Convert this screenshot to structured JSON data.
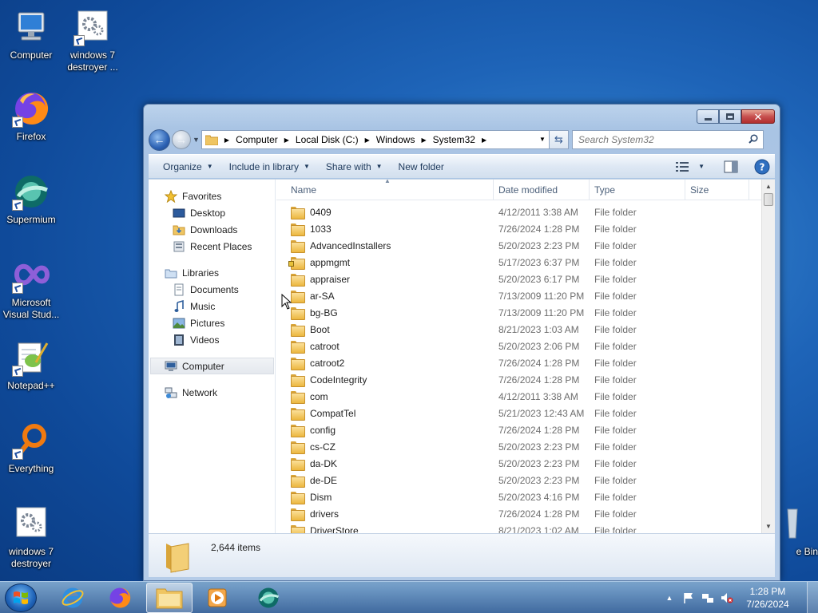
{
  "desktop": {
    "icons": [
      {
        "label": "Computer"
      },
      {
        "label": "windows 7 destroyer ..."
      },
      {
        "label": "Firefox"
      },
      {
        "label": "Supermium"
      },
      {
        "label": "Microsoft Visual Stud..."
      },
      {
        "label": "Notepad++"
      },
      {
        "label": "Everything"
      },
      {
        "label": "windows 7 destroyer"
      },
      {
        "label": "e Bin"
      }
    ]
  },
  "explorer": {
    "address": {
      "crumbs": [
        "Computer",
        "Local Disk (C:)",
        "Windows",
        "System32"
      ]
    },
    "search": {
      "placeholder": "Search System32"
    },
    "toolbar": {
      "organize": "Organize",
      "include_in_library": "Include in library",
      "share_with": "Share with",
      "new_folder": "New folder"
    },
    "nav": {
      "favorites": "Favorites",
      "desktop": "Desktop",
      "downloads": "Downloads",
      "recent_places": "Recent Places",
      "libraries": "Libraries",
      "documents": "Documents",
      "music": "Music",
      "pictures": "Pictures",
      "videos": "Videos",
      "computer": "Computer",
      "network": "Network"
    },
    "columns": {
      "name": "Name",
      "date": "Date modified",
      "type": "Type",
      "size": "Size"
    },
    "files": [
      {
        "name": "0409",
        "date": "4/12/2011 3:38 AM",
        "type": "File folder"
      },
      {
        "name": "1033",
        "date": "7/26/2024 1:28 PM",
        "type": "File folder"
      },
      {
        "name": "AdvancedInstallers",
        "date": "5/20/2023 2:23 PM",
        "type": "File folder"
      },
      {
        "name": "appmgmt",
        "date": "5/17/2023 6:37 PM",
        "type": "File folder",
        "locked": true
      },
      {
        "name": "appraiser",
        "date": "5/20/2023 6:17 PM",
        "type": "File folder"
      },
      {
        "name": "ar-SA",
        "date": "7/13/2009 11:20 PM",
        "type": "File folder"
      },
      {
        "name": "bg-BG",
        "date": "7/13/2009 11:20 PM",
        "type": "File folder"
      },
      {
        "name": "Boot",
        "date": "8/21/2023 1:03 AM",
        "type": "File folder"
      },
      {
        "name": "catroot",
        "date": "5/20/2023 2:06 PM",
        "type": "File folder"
      },
      {
        "name": "catroot2",
        "date": "7/26/2024 1:28 PM",
        "type": "File folder"
      },
      {
        "name": "CodeIntegrity",
        "date": "7/26/2024 1:28 PM",
        "type": "File folder"
      },
      {
        "name": "com",
        "date": "4/12/2011 3:38 AM",
        "type": "File folder"
      },
      {
        "name": "CompatTel",
        "date": "5/21/2023 12:43 AM",
        "type": "File folder"
      },
      {
        "name": "config",
        "date": "7/26/2024 1:28 PM",
        "type": "File folder"
      },
      {
        "name": "cs-CZ",
        "date": "5/20/2023 2:23 PM",
        "type": "File folder"
      },
      {
        "name": "da-DK",
        "date": "5/20/2023 2:23 PM",
        "type": "File folder"
      },
      {
        "name": "de-DE",
        "date": "5/20/2023 2:23 PM",
        "type": "File folder"
      },
      {
        "name": "Dism",
        "date": "5/20/2023 4:16 PM",
        "type": "File folder"
      },
      {
        "name": "drivers",
        "date": "7/26/2024 1:28 PM",
        "type": "File folder"
      },
      {
        "name": "DriverStore",
        "date": "8/21/2023 1:02 AM",
        "type": "File folder"
      }
    ],
    "status": {
      "item_count": "2,644 items"
    }
  },
  "taskbar": {
    "clock_time": "1:28 PM",
    "clock_date": "7/26/2024"
  }
}
